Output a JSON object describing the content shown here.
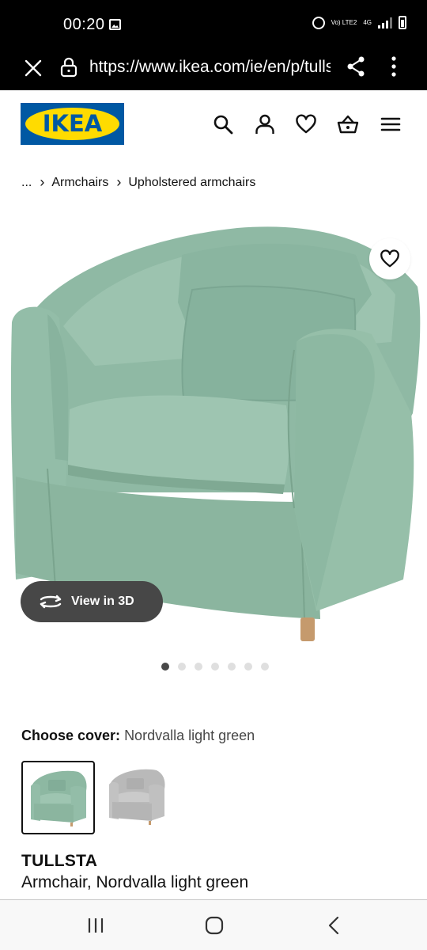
{
  "status_bar": {
    "time": "00:20",
    "network_volte": "Vo) LTE2",
    "network_type": "4G",
    "icons": [
      "gallery-icon",
      "alarm-icon",
      "signal-icon",
      "battery-icon"
    ]
  },
  "browser": {
    "url": "https://www.ikea.com/ie/en/p/tullsta",
    "icons": [
      "close-icon",
      "lock-icon",
      "share-icon",
      "more-vertical-icon"
    ]
  },
  "header": {
    "logo_text": "IKEA",
    "brand_colors": {
      "blue": "#0058a3",
      "yellow": "#ffdb00"
    },
    "icons": [
      "search-icon",
      "user-icon",
      "heart-icon",
      "basket-icon",
      "menu-icon"
    ]
  },
  "breadcrumb": {
    "items": [
      "...",
      "Armchairs",
      "Upholstered armchairs"
    ]
  },
  "gallery": {
    "view_3d_label": "View in 3D",
    "image_count": 7,
    "active_index": 0,
    "chair_color": "#8db8a2"
  },
  "product": {
    "choose_cover_label": "Choose cover:",
    "selected_cover": "Nordvalla light green",
    "cover_options": [
      {
        "name": "Nordvalla light green",
        "color": "#8db8a2",
        "selected": true
      },
      {
        "name": "grey",
        "color": "#b9b9b9",
        "selected": false
      }
    ],
    "name": "TULLSTA",
    "description": "Armchair, Nordvalla light green"
  },
  "nav_bar": {
    "icons": [
      "recents-icon",
      "home-icon",
      "back-icon"
    ]
  }
}
